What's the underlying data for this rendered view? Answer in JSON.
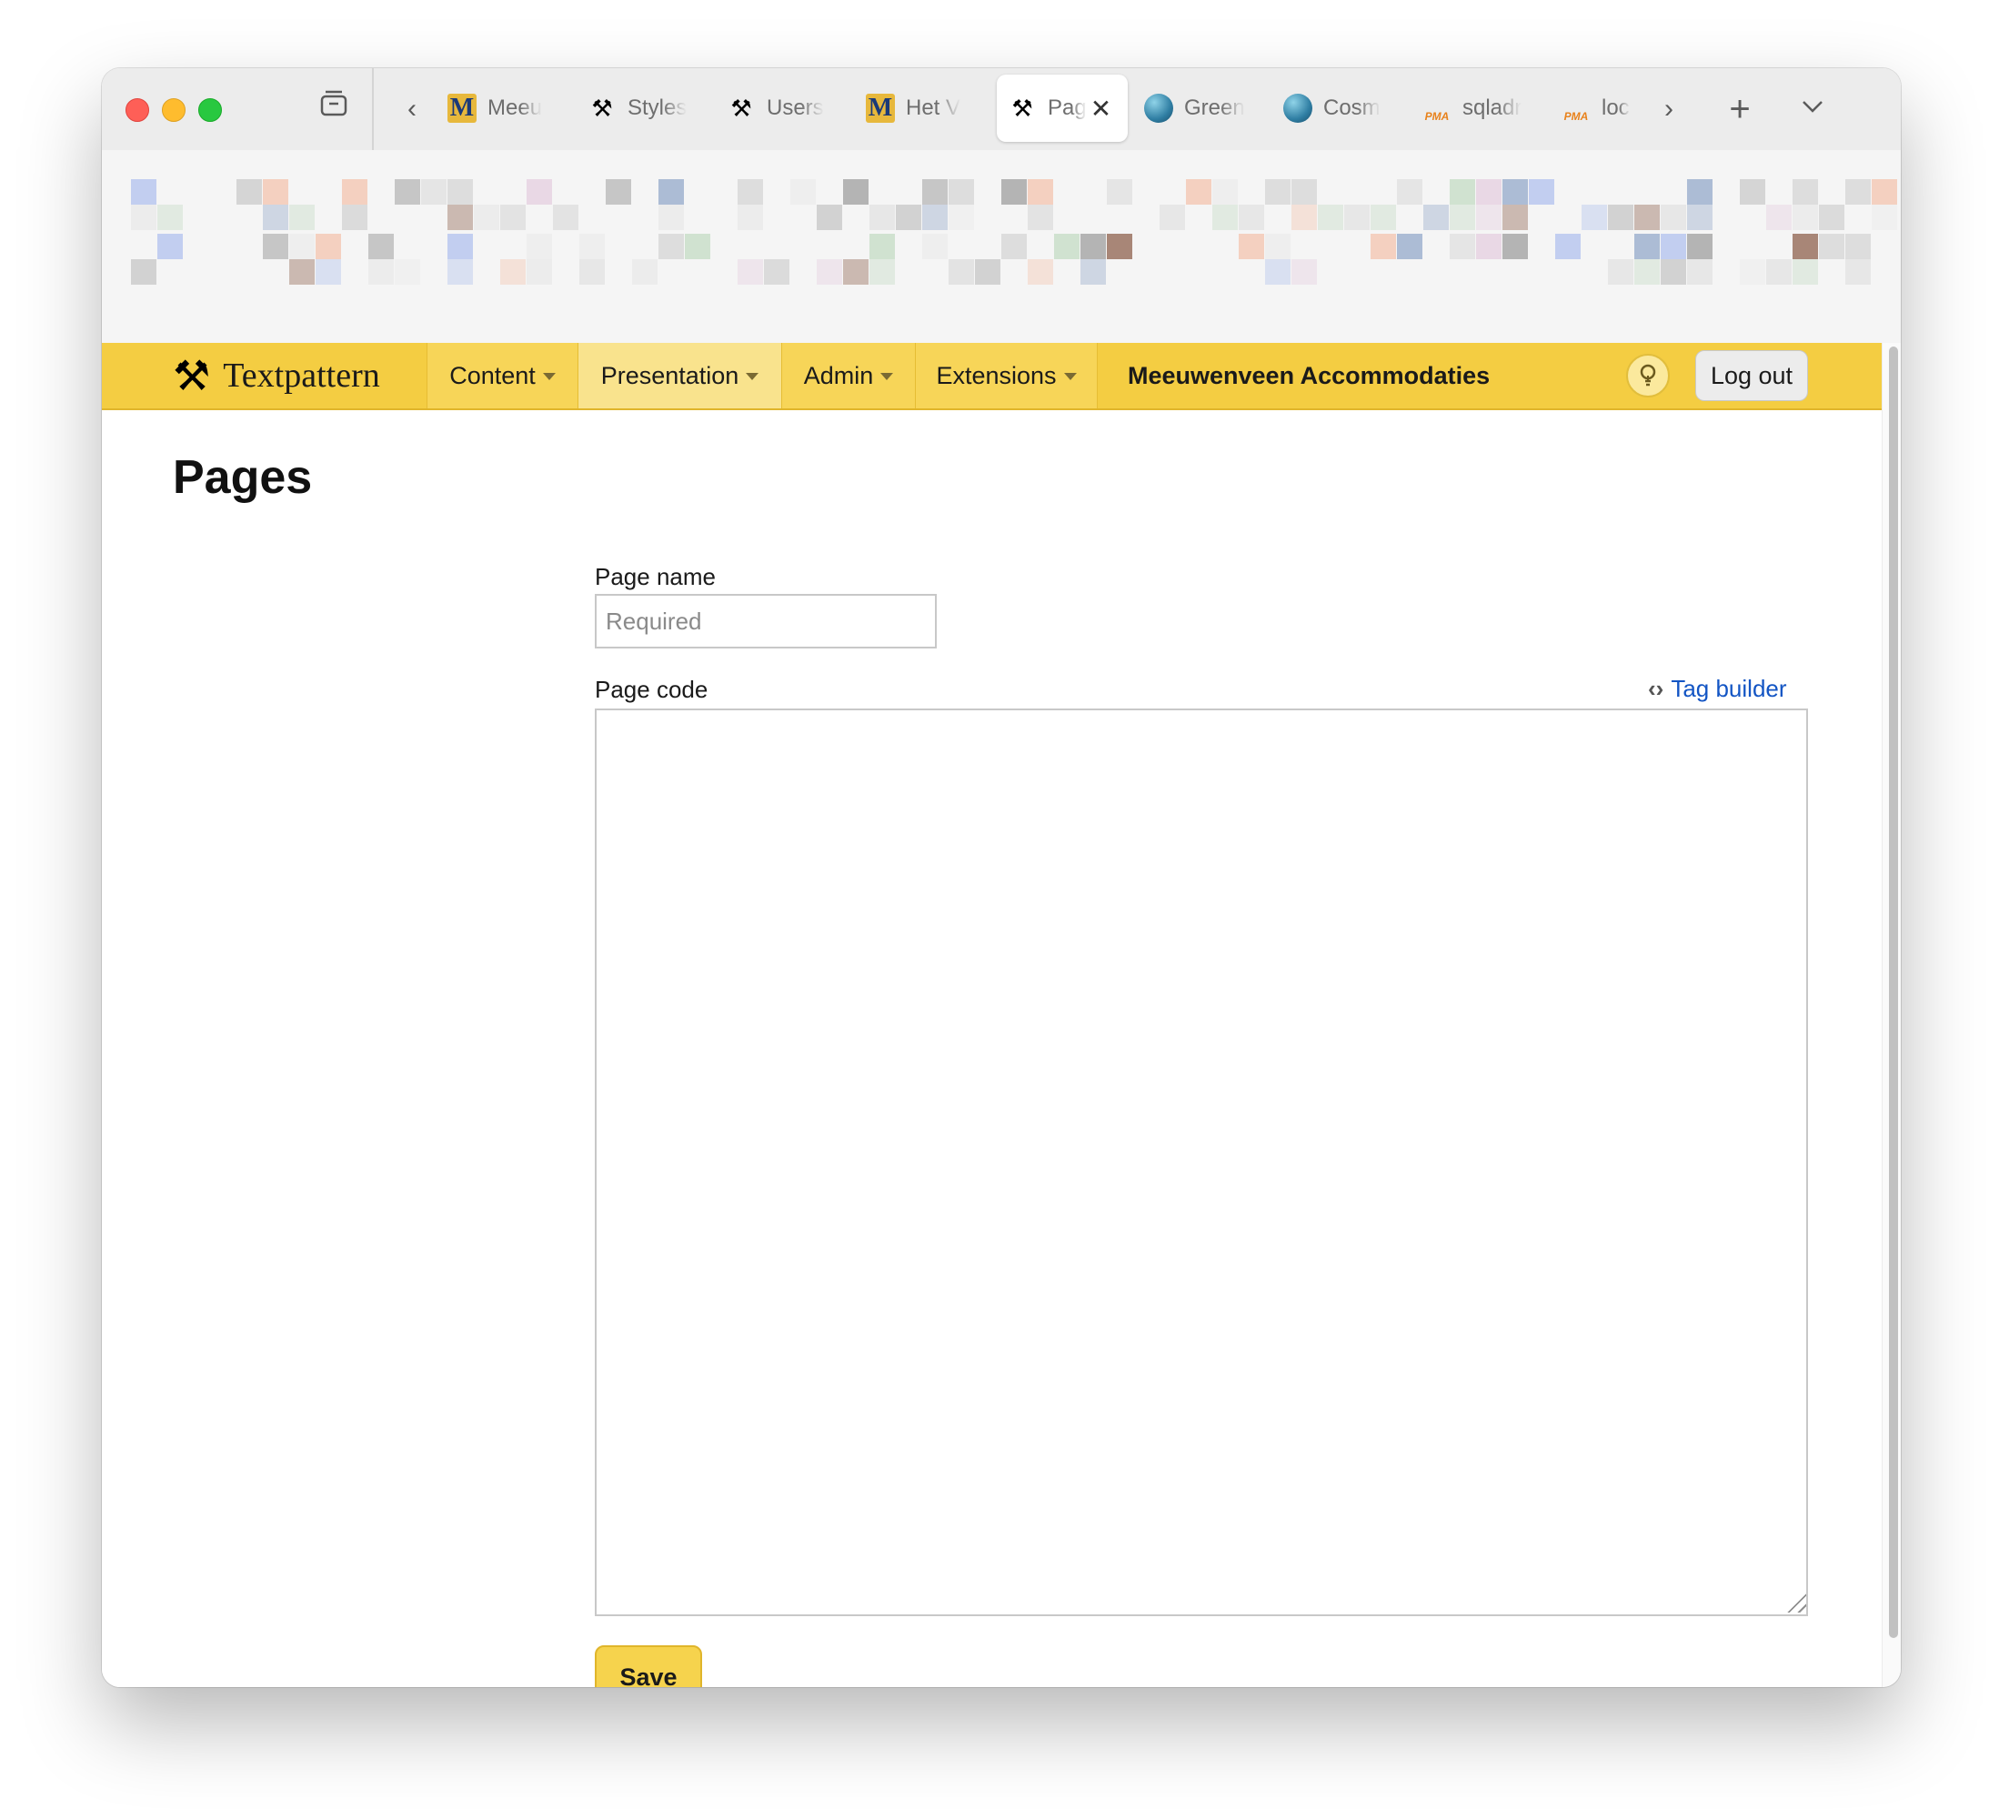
{
  "browser": {
    "tabs": [
      {
        "label": "Meeu",
        "icon": "m-favicon"
      },
      {
        "label": "Styles",
        "icon": "textpattern-favicon"
      },
      {
        "label": "Users",
        "icon": "textpattern-favicon"
      },
      {
        "label": "Het V",
        "icon": "m-favicon"
      },
      {
        "label": "Pag",
        "icon": "textpattern-favicon",
        "active": true
      },
      {
        "label": "Green",
        "icon": "globe-favicon"
      },
      {
        "label": "Cosm",
        "icon": "globe-favicon"
      },
      {
        "label": "sqladr",
        "icon": "phpmyadmin-favicon"
      },
      {
        "label": "loc",
        "icon": "phpmyadmin-favicon"
      }
    ],
    "m_glyph": "M",
    "pma_glyph": "PMA"
  },
  "app": {
    "logo_text": "Textpattern",
    "nav": [
      {
        "label": "Content"
      },
      {
        "label": "Presentation"
      },
      {
        "label": "Admin"
      },
      {
        "label": "Extensions"
      }
    ],
    "site_name": "Meeuwenveen Accommodaties",
    "logout_label": "Log out"
  },
  "main": {
    "title": "Pages",
    "page_name_label": "Page name",
    "page_name_placeholder": "Required",
    "page_name_value": "",
    "page_code_label": "Page code",
    "tag_builder_label": "Tag builder",
    "page_code_value": "",
    "save_label": "Save"
  },
  "colors": {
    "header": "#f4cd42",
    "nav_selected": "#f9e38d",
    "link": "#1355c4",
    "save_button": "#f6d34d"
  }
}
